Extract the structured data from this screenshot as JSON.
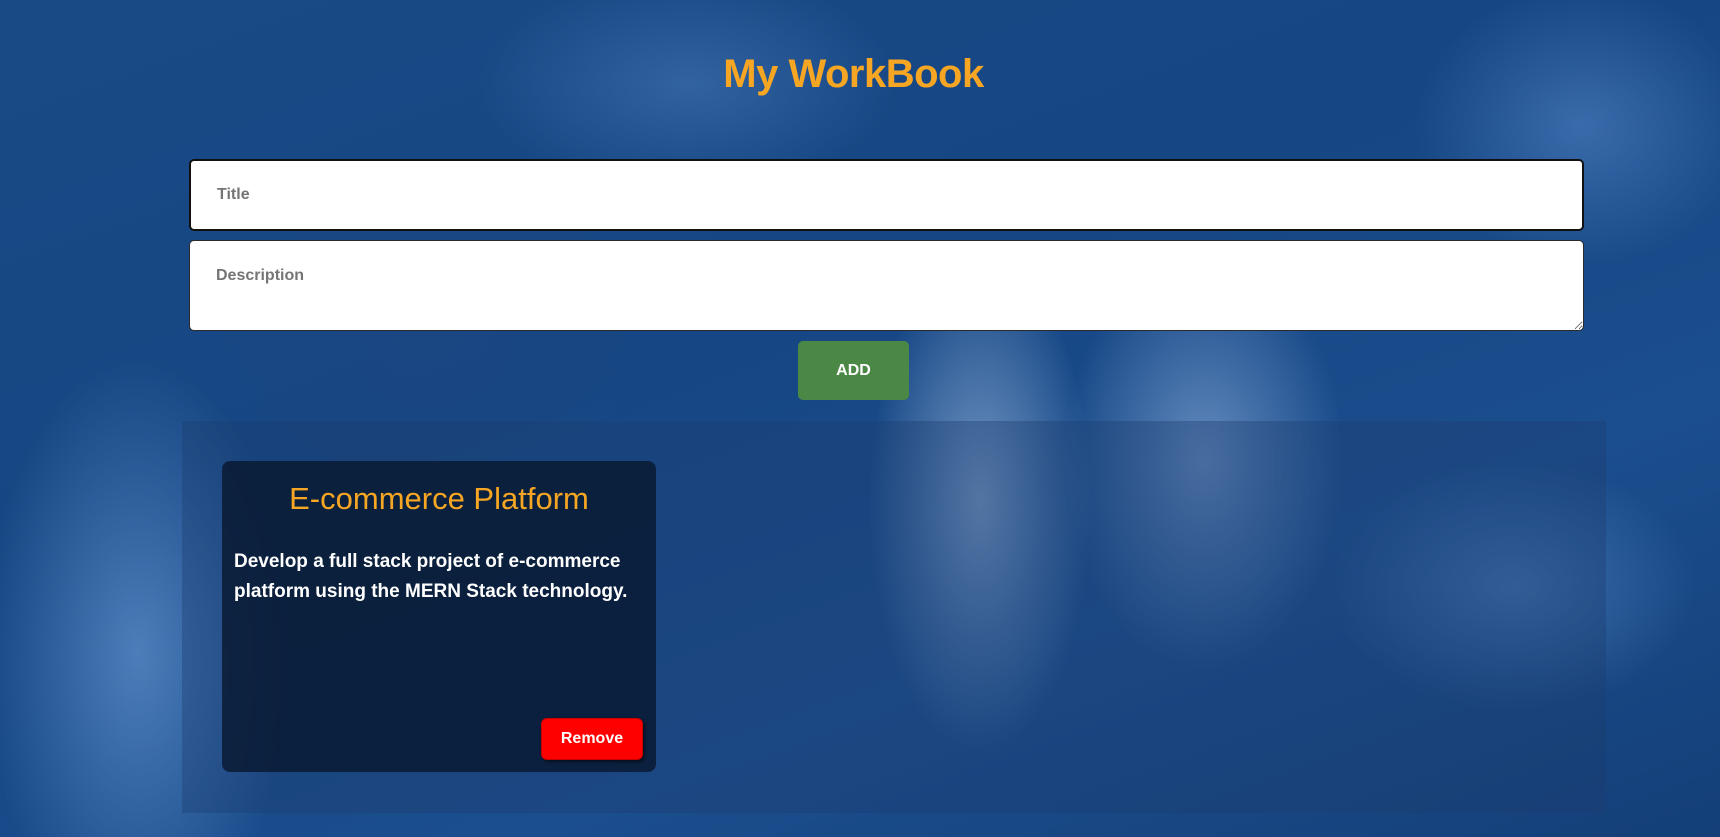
{
  "header": {
    "title": "My WorkBook"
  },
  "form": {
    "title_placeholder": "Title",
    "title_value": "",
    "description_placeholder": "Description",
    "description_value": "",
    "add_label": "ADD"
  },
  "notes": [
    {
      "title": "E-commerce Platform",
      "description": "Develop a full stack project of e-commerce platform using the MERN Stack technology.",
      "remove_label": "Remove"
    }
  ],
  "colors": {
    "accent": "#f6a623",
    "add_button": "#4b8845",
    "remove_button": "#ff0000",
    "background": "#164683"
  }
}
